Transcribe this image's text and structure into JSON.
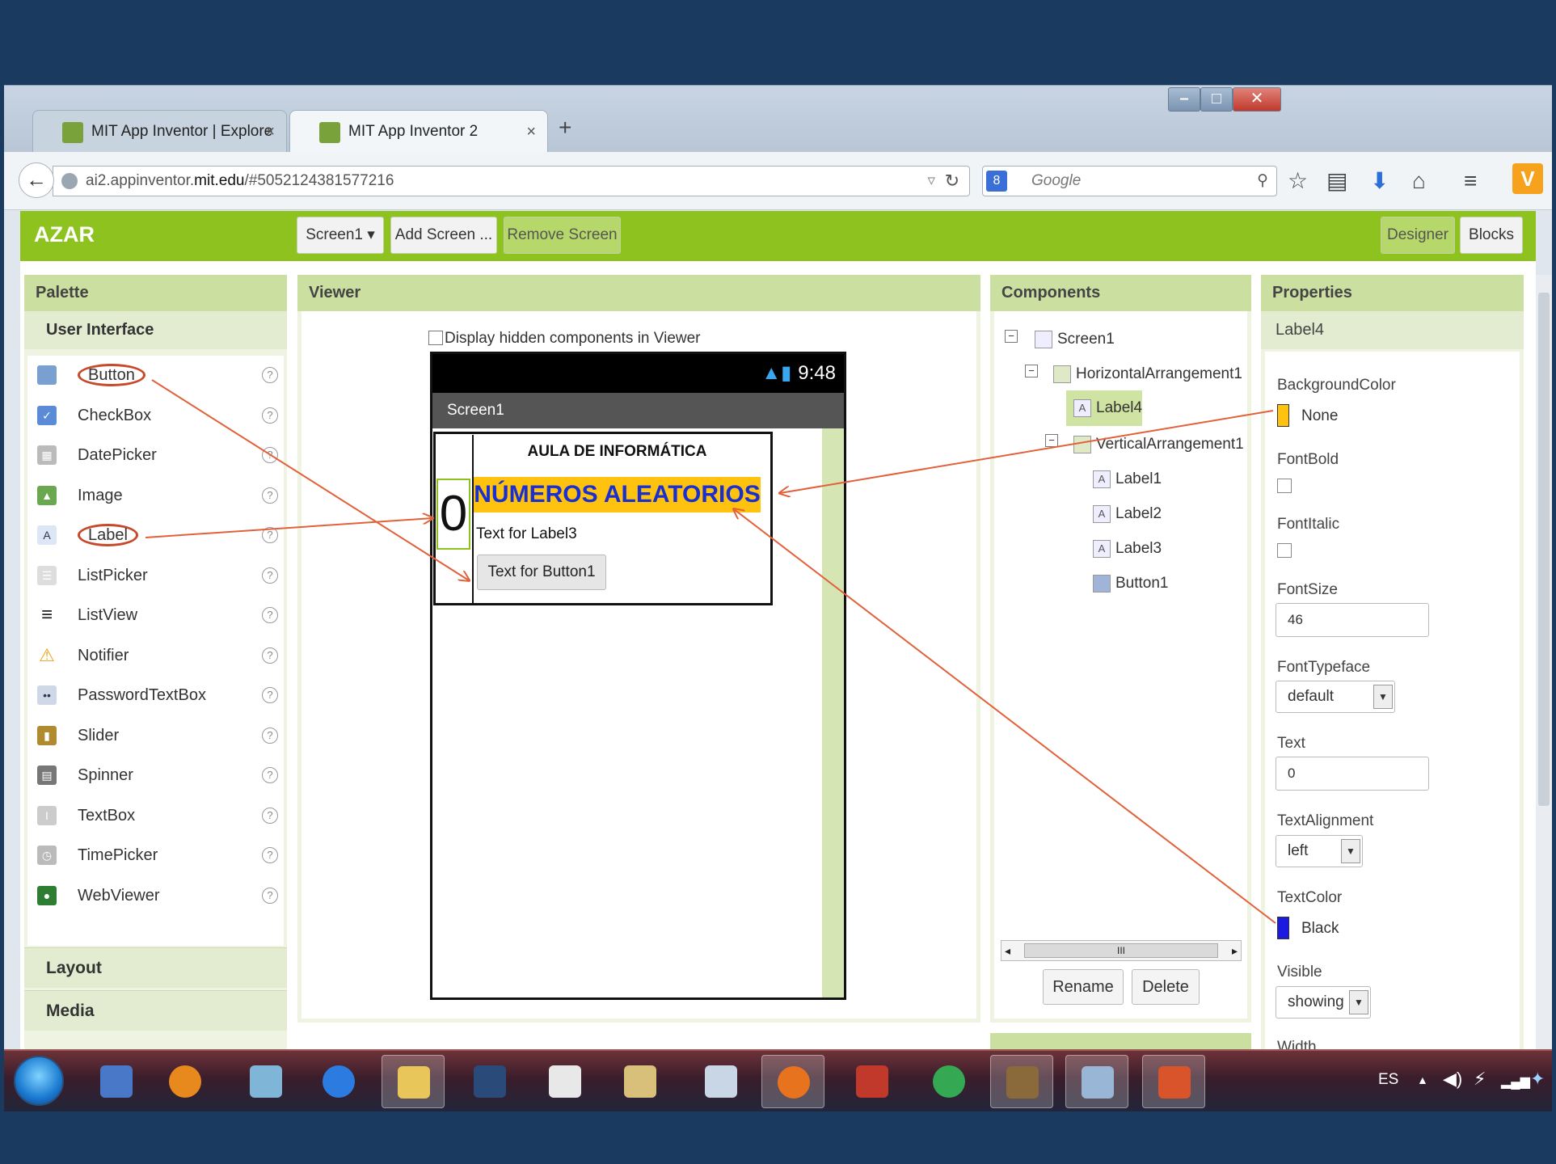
{
  "browser": {
    "tabs": [
      {
        "title": "MIT App Inventor | Explore ...",
        "close": "×"
      },
      {
        "title": "MIT App Inventor 2",
        "close": "×"
      }
    ],
    "new_tab": "+",
    "url_prefix": "ai2.appinventor.",
    "url_host": "mit.edu",
    "url_path": "/#5052124381577216",
    "search_placeholder": "Google",
    "window_buttons": [
      "–",
      "□",
      "✕"
    ]
  },
  "app": {
    "project_name": "AZAR",
    "screen_select": "Screen1 ▾",
    "add_screen": "Add Screen ...",
    "remove_screen": "Remove Screen",
    "designer": "Designer",
    "blocks": "Blocks"
  },
  "palette": {
    "title": "Palette",
    "category": "User Interface",
    "items": [
      {
        "label": "Button",
        "icon": "button-icon",
        "color": "#7aa0d0",
        "circled": true
      },
      {
        "label": "CheckBox",
        "icon": "checkbox-icon",
        "color": "#5b8bd6",
        "circled": false
      },
      {
        "label": "DatePicker",
        "icon": "calendar-icon",
        "color": "#bbbbbb",
        "circled": false
      },
      {
        "label": "Image",
        "icon": "image-icon",
        "color": "#6aa84f",
        "circled": false
      },
      {
        "label": "Label",
        "icon": "label-icon",
        "color": "#dde6f5",
        "circled": true
      },
      {
        "label": "ListPicker",
        "icon": "list-icon",
        "color": "#dddddd",
        "circled": false
      },
      {
        "label": "ListView",
        "icon": "listview-icon",
        "color": "#222222",
        "circled": false
      },
      {
        "label": "Notifier",
        "icon": "warning-icon",
        "color": "#e8a317",
        "circled": false
      },
      {
        "label": "PasswordTextBox",
        "icon": "password-icon",
        "color": "#cfd8e6",
        "circled": false
      },
      {
        "label": "Slider",
        "icon": "slider-icon",
        "color": "#b08a2e",
        "circled": false
      },
      {
        "label": "Spinner",
        "icon": "spinner-icon",
        "color": "#777777",
        "circled": false
      },
      {
        "label": "TextBox",
        "icon": "textbox-icon",
        "color": "#cccccc",
        "circled": false
      },
      {
        "label": "TimePicker",
        "icon": "clock-icon",
        "color": "#bbbbbb",
        "circled": false
      },
      {
        "label": "WebViewer",
        "icon": "globe-icon",
        "color": "#2e7d32",
        "circled": false
      }
    ],
    "help_glyph": "?",
    "layout": "Layout",
    "media": "Media"
  },
  "viewer": {
    "title": "Viewer",
    "hidden_checkbox": "Display hidden components in Viewer",
    "status_time": "9:48",
    "screen_title": "Screen1",
    "label4_text": "0",
    "label1_text": "AULA DE INFORMÁTICA",
    "label2_text": "NÚMEROS ALEATORIOS",
    "label3_text": "Text for Label3",
    "button1_text": "Text for Button1"
  },
  "components": {
    "title": "Components",
    "tree": [
      {
        "name": "Screen1",
        "icon": "screen-icon"
      },
      {
        "name": "HorizontalArrangement1",
        "icon": "horizontal-arrangement-icon"
      },
      {
        "name": "Label4",
        "icon": "label-icon",
        "selected": true
      },
      {
        "name": "VerticalArrangement1",
        "icon": "vertical-arrangement-icon"
      },
      {
        "name": "Label1",
        "icon": "label-icon"
      },
      {
        "name": "Label2",
        "icon": "label-icon"
      },
      {
        "name": "Label3",
        "icon": "label-icon"
      },
      {
        "name": "Button1",
        "icon": "button-icon"
      }
    ],
    "rename": "Rename",
    "delete": "Delete",
    "scroll_grip": "III"
  },
  "properties": {
    "title": "Properties",
    "component": "Label4",
    "background_color_label": "BackgroundColor",
    "background_color_value": "None",
    "background_swatch": "#ffc20e",
    "fontbold_label": "FontBold",
    "fontitalic_label": "FontItalic",
    "fontsize_label": "FontSize",
    "fontsize_value": "46",
    "fonttypeface_label": "FontTypeface",
    "fonttypeface_value": "default",
    "text_label": "Text",
    "text_value": "0",
    "textalignment_label": "TextAlignment",
    "textalignment_value": "left",
    "textcolor_label": "TextColor",
    "textcolor_value": "Black",
    "textcolor_swatch": "#1a1ae0",
    "visible_label": "Visible",
    "visible_value": "showing",
    "width_label": "Width"
  },
  "taskbar": {
    "language": "ES",
    "apps": [
      "start-orb",
      "paint-icon",
      "media-icon",
      "notebook-icon",
      "ie-icon",
      "folder-icon",
      "tc-icon",
      "chart-icon",
      "explorer-icon",
      "mail-icon",
      "firefox-icon",
      "book-icon",
      "chrome-icon",
      "gimp-icon",
      "computer-icon",
      "powerpoint-icon"
    ]
  },
  "colors": {
    "app_green": "#8dc21f",
    "annotation_arrow": "#e0613a",
    "background": "#1b3a5f"
  }
}
